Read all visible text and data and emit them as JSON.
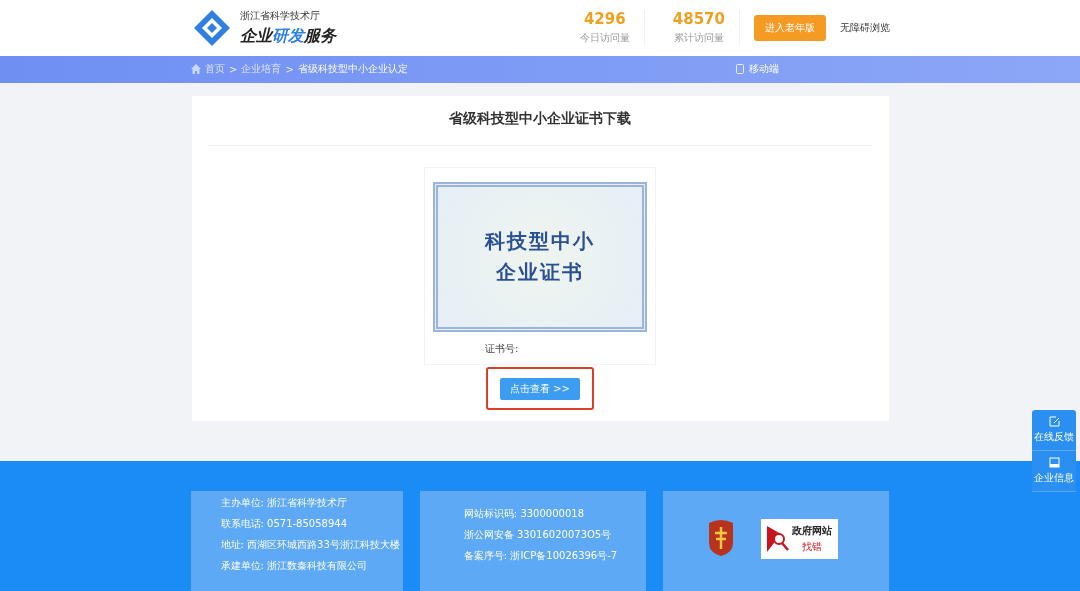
{
  "header": {
    "org": "浙江省科学技术厅",
    "site": "企业",
    "site_accent": "研发",
    "site_tail": "服务",
    "stats": [
      {
        "value": "4296",
        "label": "今日访问量"
      },
      {
        "value": "48570",
        "label": "累计访问量"
      }
    ],
    "elder_button": "进入老年版",
    "accessibility_link": "无障碍浏览"
  },
  "nav": {
    "breadcrumb": [
      {
        "label": "首页",
        "current": false
      },
      {
        "label": "企业培育",
        "current": false
      },
      {
        "label": "省级科技型中小企业认定",
        "current": true
      }
    ],
    "separator": ">",
    "mobile": "移动端"
  },
  "card": {
    "title": "省级科技型中小企业证书下载",
    "certificate_lines": [
      "科技型中小",
      "企业证书"
    ],
    "cert_no_label": "证书号:",
    "view_button": "点击查看 >>",
    "highlighted": true
  },
  "side": [
    {
      "kind": "feedback",
      "label": "在线反馈"
    },
    {
      "kind": "info",
      "label": "企业信息"
    }
  ],
  "footer": {
    "col1": [
      "主办单位: 浙江省科学技术厅",
      "联系电话: 0571-85058944",
      "地址: 西湖区环城西路33号浙江科技大楼",
      "承建单位: 浙江数秦科技有限公司"
    ],
    "col2": [
      "网站标识码: 3300000018",
      "浙公网安备 33016020073O5号",
      "备案序号: 浙ICP备10026396号-7"
    ],
    "badge_title": "政府网站",
    "badge_sub": "找错"
  }
}
